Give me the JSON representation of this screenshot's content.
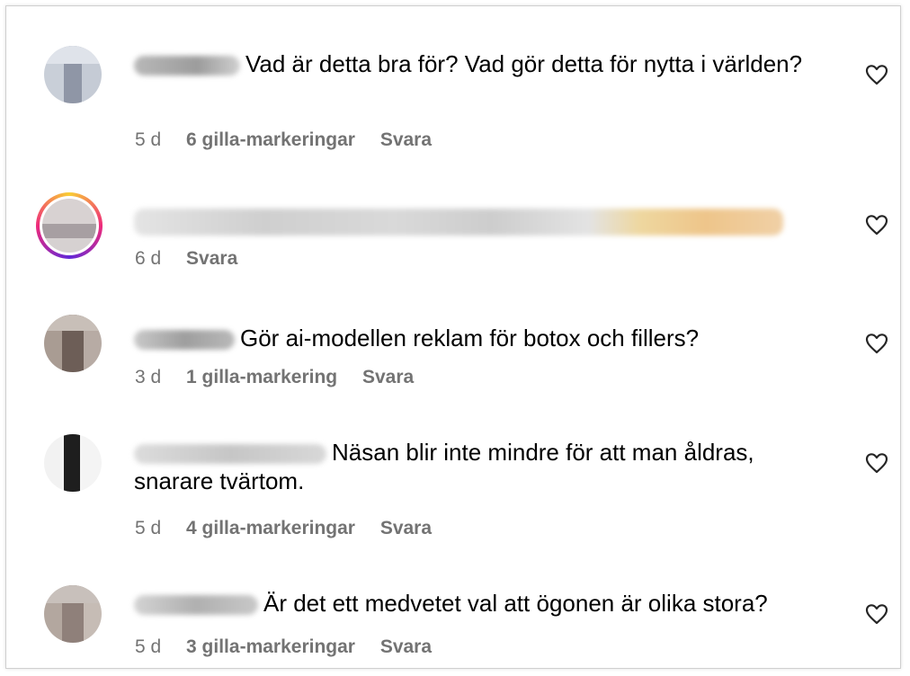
{
  "comments": [
    {
      "text": "Vad är detta bra för? Vad gör detta för nytta i världen?",
      "time": "5 d",
      "likes": "6 gilla-markeringar",
      "reply": "Svara"
    },
    {
      "text": "",
      "time": "6 d",
      "likes": "",
      "reply": "Svara"
    },
    {
      "text": "Gör ai-modellen reklam för botox och fillers?",
      "time": "3 d",
      "likes": "1 gilla-markering",
      "reply": "Svara"
    },
    {
      "text": "Näsan blir inte mindre för att man åldras, snarare tvärtom.",
      "time": "5 d",
      "likes": "4 gilla-markeringar",
      "reply": "Svara"
    },
    {
      "text": "Är det ett medvetet val att ögonen är olika stora?",
      "time": "5 d",
      "likes": "3 gilla-markeringar",
      "reply": "Svara"
    }
  ],
  "icons": {
    "like": "heart-outline-icon"
  },
  "colors": {
    "meta": "#737373",
    "text": "#000000",
    "story_ring": "#ee2a7b"
  }
}
